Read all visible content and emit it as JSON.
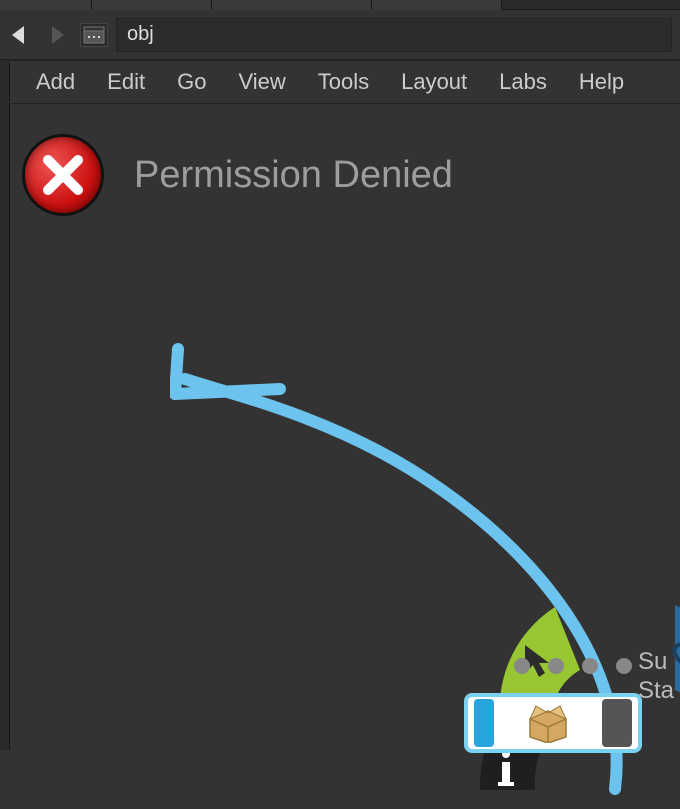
{
  "tabs": {
    "items": [
      {
        "label": ""
      },
      {
        "label": ""
      },
      {
        "label": ""
      },
      {
        "label": ""
      }
    ]
  },
  "nav": {
    "path_label": "obj"
  },
  "menu": {
    "items": [
      {
        "label": "Add"
      },
      {
        "label": "Edit"
      },
      {
        "label": "Go"
      },
      {
        "label": "View"
      },
      {
        "label": "Tools"
      },
      {
        "label": "Layout"
      },
      {
        "label": "Labs"
      },
      {
        "label": "Help"
      }
    ]
  },
  "error": {
    "message": "Permission Denied"
  },
  "radial": {
    "sector_select": {
      "name": "select-cursor-icon",
      "color": "#98c633"
    },
    "sector_eye": {
      "name": "eye-icon",
      "color": "#2a6aa0"
    },
    "sector_info": {
      "name": "info-icon",
      "color": "#2a2a2a"
    },
    "side_label_1": "Su",
    "side_label_2": "Sta"
  },
  "pager": {
    "count": 4
  }
}
